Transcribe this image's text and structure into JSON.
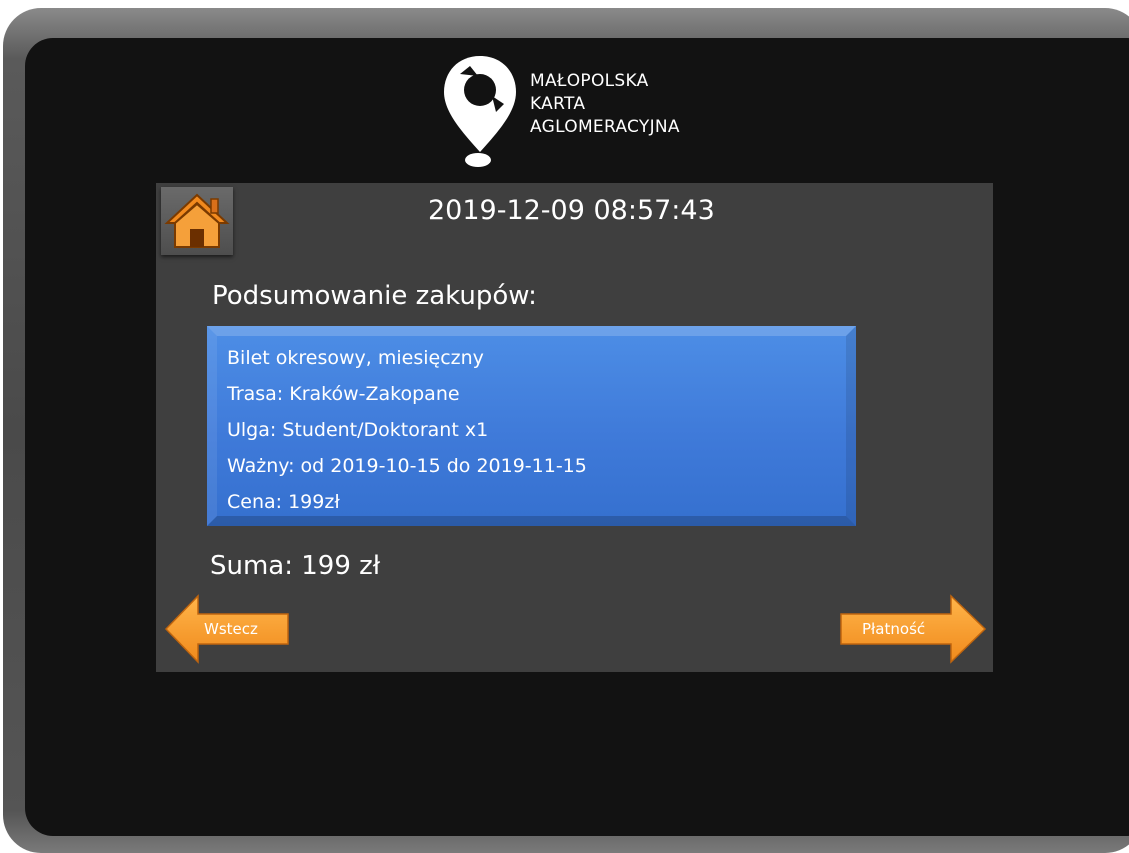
{
  "logo": {
    "line1": "MAŁOPOLSKA",
    "line2": "KARTA",
    "line3": "AGLOMERACYJNA"
  },
  "header": {
    "datetime": "2019-12-09 08:57:43"
  },
  "summary": {
    "heading": "Podsumowanie zakupów:",
    "items": [
      "Bilet okresowy, miesięczny",
      "Trasa: Kraków-Zakopane",
      "Ulga: Student/Doktorant  x1",
      "Ważny: od 2019-10-15 do 2019-11-15",
      "Cena: 199zł"
    ],
    "total": "Suma: 199 zł"
  },
  "nav": {
    "back_label": "Wstecz",
    "pay_label": "Płatność"
  },
  "colors": {
    "accent_orange": "#f39a2a",
    "order_box_blue": "#3f7ad9",
    "panel_gray": "#3f3f3f"
  }
}
